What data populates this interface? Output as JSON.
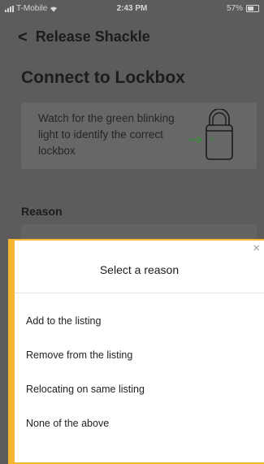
{
  "status_bar": {
    "carrier": "T-Mobile",
    "time": "2:43 PM",
    "battery": "57%"
  },
  "nav": {
    "back_icon": "chevron-left-icon",
    "title": "Release Shackle"
  },
  "heading": "Connect to Lockbox",
  "info_card": {
    "text": "Watch for the green blinking light to identify the correct lockbox",
    "icon": "lockbox-illustration"
  },
  "reason": {
    "label": "Reason"
  },
  "sheet": {
    "title": "Select a reason",
    "close_icon": "close-icon",
    "options": [
      {
        "label": "Add to the listing"
      },
      {
        "label": "Remove from the listing"
      },
      {
        "label": "Relocating on same listing"
      },
      {
        "label": "None of the above"
      }
    ]
  },
  "colors": {
    "accent": "#f5b731",
    "overlay": "#5c5c5c",
    "lockbox_arrow": "#3e8a3e"
  }
}
